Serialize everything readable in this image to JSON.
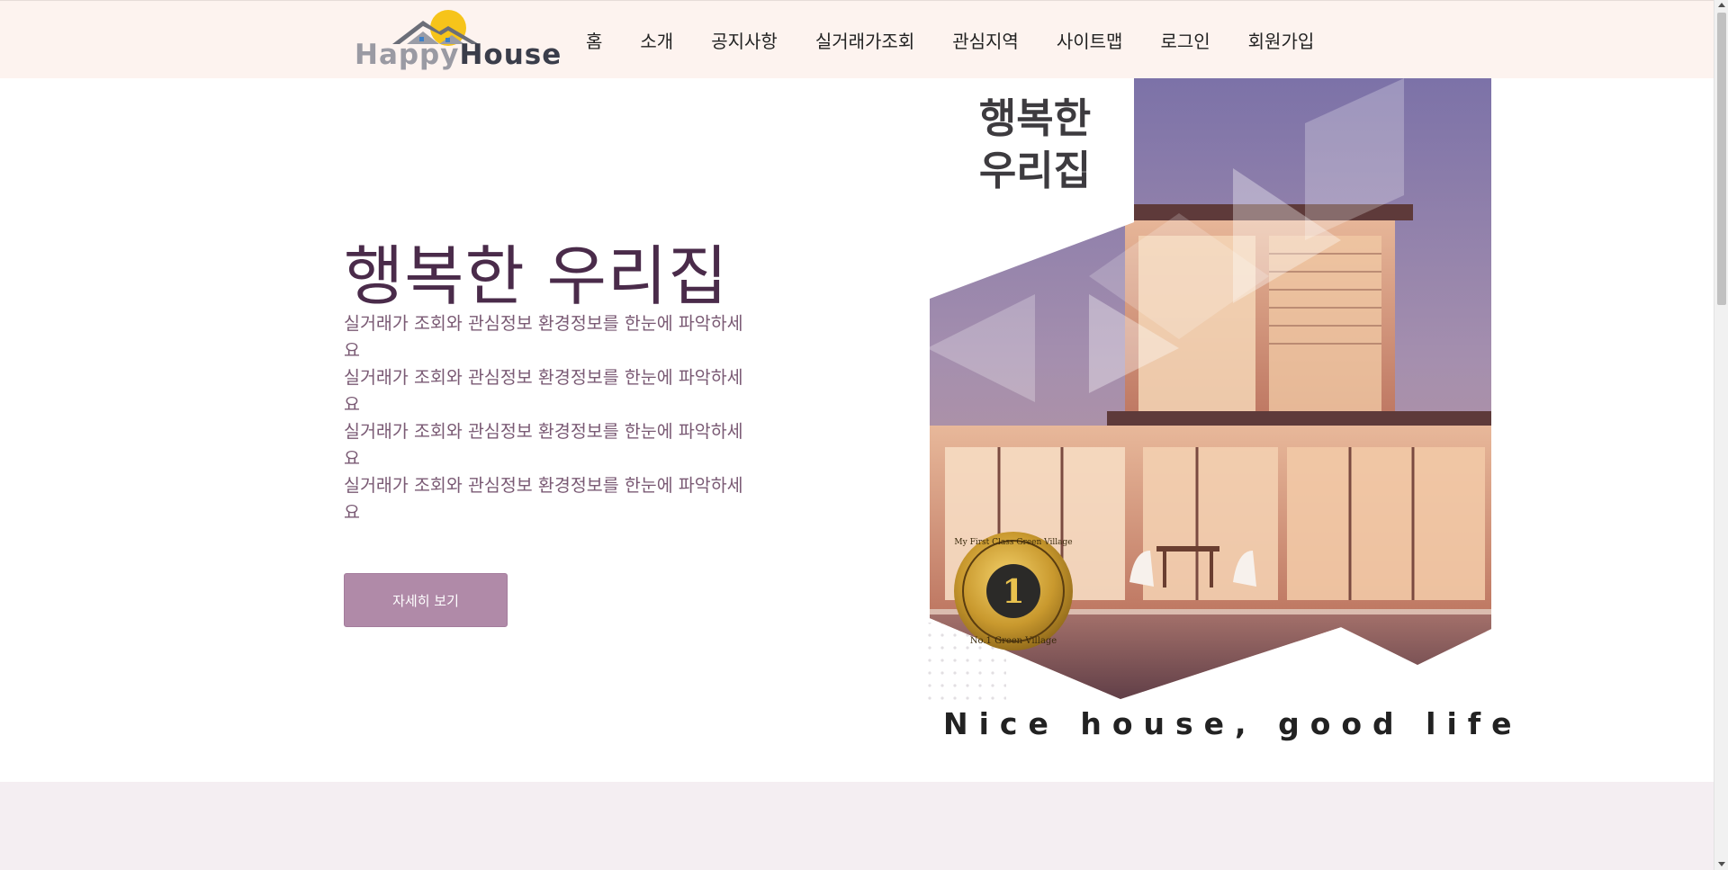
{
  "logo": {
    "part1": "Happy",
    "part2": "House"
  },
  "nav": {
    "items": [
      {
        "label": "홈"
      },
      {
        "label": "소개"
      },
      {
        "label": "공지사항"
      },
      {
        "label": "실거래가조회"
      },
      {
        "label": "관심지역"
      },
      {
        "label": "사이트맵"
      },
      {
        "label": "로그인"
      },
      {
        "label": "회원가입"
      }
    ]
  },
  "hero": {
    "title": "행복한 우리집",
    "description": [
      "실거래가 조회와 관심정보 환경정보를 한눈에 파악하세요",
      "실거래가 조회와 관심정보 환경정보를 한눈에 파악하세요",
      "실거래가 조회와 관심정보 환경정보를 한눈에 파악하세요",
      "실거래가 조회와 관심정보 환경정보를 한눈에 파악하세요"
    ],
    "button_label": "자세히 보기"
  },
  "art": {
    "overlay_title_line1": "행복한",
    "overlay_title_line2": "우리집",
    "badge_number": "1",
    "badge_top_text": "My First Class  Green Village",
    "badge_bottom_text": "No.1 Green Village",
    "tagline": "Nice house, good life"
  },
  "colors": {
    "header_bg": "#fdf3ef",
    "title": "#4a2b4a",
    "desc": "#7a5a74",
    "button_bg": "#b08aa8",
    "lower_band": "#f4eef2"
  }
}
